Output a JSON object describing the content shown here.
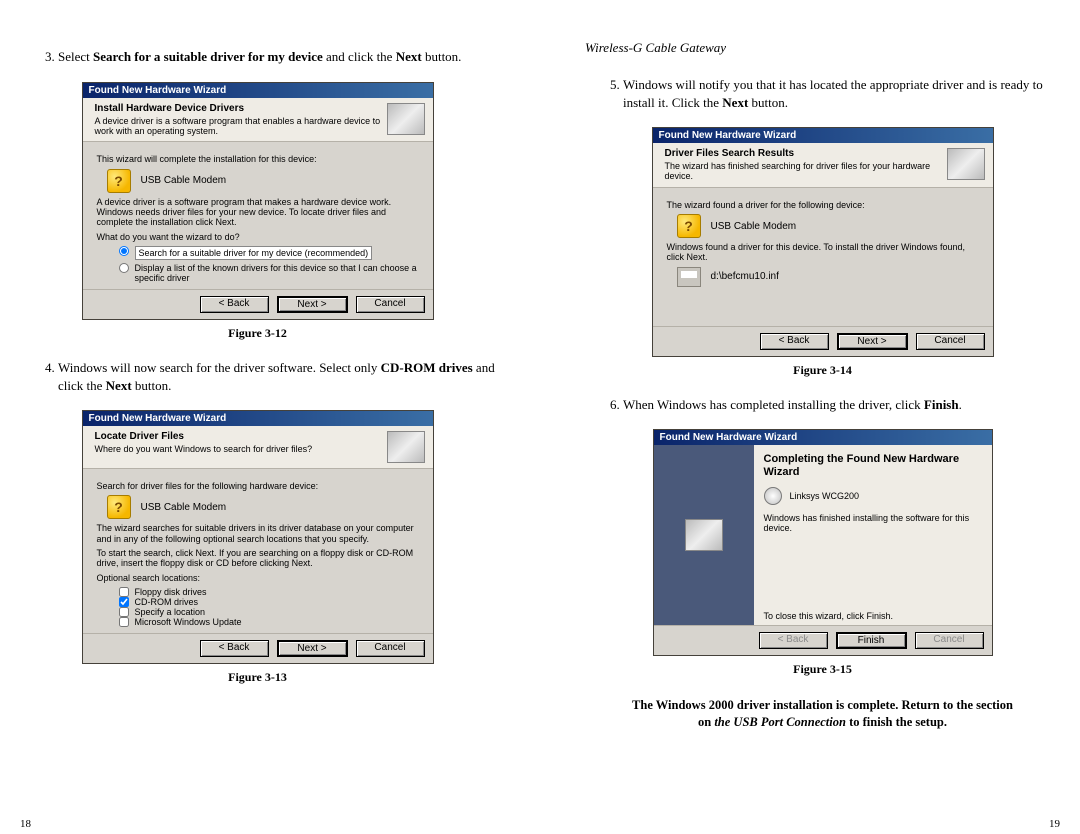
{
  "header_right": "Wireless-G Cable Gateway",
  "page_left_num": "18",
  "page_right_num": "19",
  "steps": {
    "s3_a": "Select ",
    "s3_b": "Search for a suitable driver for my device",
    "s3_c": " and click the ",
    "s3_d": "Next",
    "s3_e": " button.",
    "s4_a": "Windows will now search for the driver software. Select only ",
    "s4_b": "CD-ROM drives",
    "s4_c": " and click the ",
    "s4_d": "Next",
    "s4_e": " button.",
    "s5_a": "Windows will notify you that it has located the appropriate driver and is ready to install it. Click the ",
    "s5_b": "Next",
    "s5_c": " button.",
    "s6_a": "When Windows has completed installing the driver, click ",
    "s6_b": "Finish",
    "s6_c": "."
  },
  "figcaps": {
    "f12": "Figure 3-12",
    "f13": "Figure 3-13",
    "f14": "Figure 3-14",
    "f15": "Figure 3-15"
  },
  "note": {
    "l1": "The Windows 2000 driver installation is complete.  Return to the section",
    "l2a": "on ",
    "l2b": "the USB Port Connection",
    "l2c": " to finish the setup."
  },
  "dlg_common": {
    "title": "Found New Hardware Wizard",
    "device": "USB Cable Modem",
    "back": "< Back",
    "next": "Next >",
    "cancel": "Cancel",
    "finish": "Finish"
  },
  "dlg12": {
    "banner_h": "Install Hardware Device Drivers",
    "banner_s": "A device driver is a software program that enables a hardware device to work with an operating system.",
    "p1": "This wizard will complete the installation for this device:",
    "p2": "A device driver is a software program that makes a hardware device work. Windows needs driver files for your new device. To locate driver files and complete the installation click Next.",
    "p3": "What do you want the wizard to do?",
    "opt1": "Search for a suitable driver for my device (recommended)",
    "opt2": "Display a list of the known drivers for this device so that I can choose a specific driver"
  },
  "dlg13": {
    "banner_h": "Locate Driver Files",
    "banner_s": "Where do you want Windows to search for driver files?",
    "p1": "Search for driver files for the following hardware device:",
    "p2": "The wizard searches for suitable drivers in its driver database on your computer and in any of the following optional search locations that you specify.",
    "p3": "To start the search, click Next. If you are searching on a floppy disk or CD-ROM drive, insert the floppy disk or CD before clicking Next.",
    "p4": "Optional search locations:",
    "c1": "Floppy disk drives",
    "c2": "CD-ROM drives",
    "c3": "Specify a location",
    "c4": "Microsoft Windows Update"
  },
  "dlg14": {
    "banner_h": "Driver Files Search Results",
    "banner_s": "The wizard has finished searching for driver files for your hardware device.",
    "p1": "The wizard found a driver for the following device:",
    "p2": "Windows found a driver for this device. To install the driver Windows found, click Next.",
    "path": "d:\\befcmu10.inf"
  },
  "dlg15": {
    "h1": "Completing the Found New Hardware Wizard",
    "dev": "Linksys WCG200",
    "p1": "Windows has finished installing the software for this device.",
    "p2": "To close this wizard, click Finish."
  }
}
